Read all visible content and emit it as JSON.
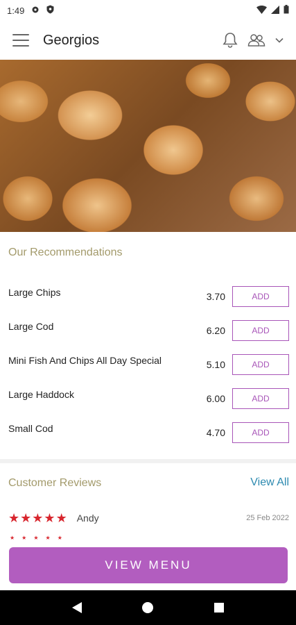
{
  "status_bar": {
    "time": "1:49",
    "icons": [
      "gear-icon",
      "shield-icon",
      "wifi-icon",
      "signal-icon",
      "battery-icon"
    ]
  },
  "app_bar": {
    "title": "Georgios",
    "icons": [
      "menu-icon",
      "bell-icon",
      "users-icon",
      "chevron-down-icon"
    ]
  },
  "recommendations": {
    "title": "Our Recommendations",
    "add_label": "ADD",
    "items": [
      {
        "name": "Large Chips",
        "price": "3.70"
      },
      {
        "name": "Large Cod",
        "price": "6.20"
      },
      {
        "name": "Mini Fish And Chips All Day Special",
        "price": "5.10"
      },
      {
        "name": "Large Haddock",
        "price": "6.00"
      },
      {
        "name": "Small Cod",
        "price": "4.70"
      }
    ]
  },
  "reviews": {
    "title": "Customer Reviews",
    "view_all": "View All",
    "items": [
      {
        "reviewer": "Andy",
        "date": "25 Feb 2022",
        "rating": 5
      }
    ]
  },
  "view_menu_label": "VIEW MENU",
  "colors": {
    "accent": "#b25dbf",
    "section_title": "#a39a6b",
    "link": "#2d8ab0",
    "star": "#d8262e"
  }
}
